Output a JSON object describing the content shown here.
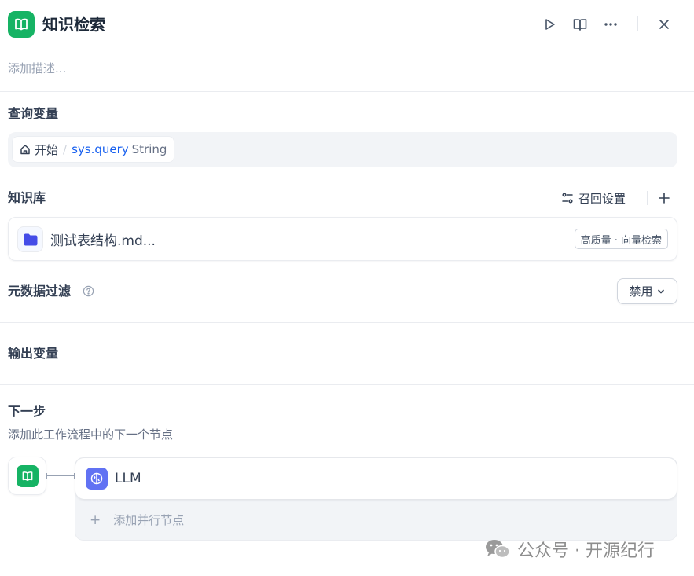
{
  "header": {
    "title": "知识检索",
    "icons": [
      "book-open-icon",
      "play-icon",
      "book-icon",
      "more-icon",
      "close-icon"
    ]
  },
  "description_placeholder": "添加描述...",
  "query_section": {
    "title": "查询变量",
    "start_label": "开始",
    "separator": "/",
    "variable_name": "sys.query",
    "variable_type": "String"
  },
  "knowledge_section": {
    "title": "知识库",
    "recall_label": "召回设置",
    "items": [
      {
        "name": "测试表结构.md...",
        "badge": "高质量 · 向量检索"
      }
    ]
  },
  "metadata_section": {
    "title": "元数据过滤",
    "select_value": "禁用"
  },
  "output_section": {
    "title": "输出变量"
  },
  "next_section": {
    "title": "下一步",
    "description": "添加此工作流程中的下一个节点",
    "next_node_label": "LLM",
    "add_parallel_label": "添加并行节点"
  },
  "watermark": {
    "text": "公众号 · 开源纪行"
  },
  "colors": {
    "knowledge_green": "#16b364",
    "llm_indigo": "#6172f3",
    "folder_blue": "#444ce7",
    "variable_blue": "#155eef"
  }
}
